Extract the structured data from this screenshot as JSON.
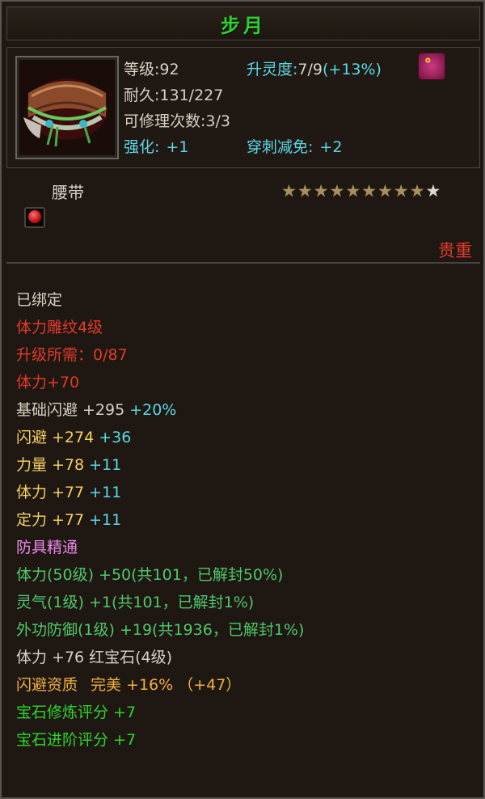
{
  "title": "步月",
  "header": {
    "level": "等级:92",
    "soul_label": "升灵度:",
    "soul_value": "7/9",
    "soul_bonus": "(+13%)",
    "durability": "耐久:131/227",
    "repair": "可修理次数:3/3",
    "enhance_label": "强化:",
    "enhance_value": "+1",
    "pierce_label": "穿刺减免:",
    "pierce_value": "+2",
    "soul_icon": "soul-glyph-icon"
  },
  "item": {
    "type": "腰带",
    "stars_total": 10,
    "stars_filled": 9,
    "rarity": "贵重"
  },
  "attributes": {
    "bound": "已绑定",
    "engrave": "体力雕纹4级",
    "upgrade": "升级所需：0/87",
    "stamina_engrave": "体力+70",
    "base_dodge_label": "基础闪避",
    "base_dodge_value": "+295",
    "base_dodge_bonus": "+20%",
    "dodge_label": "闪避",
    "dodge_value": "+274",
    "dodge_bonus": "+36",
    "power_label": "力量",
    "power_value": "+78",
    "power_bonus": "+11",
    "stamina_label": "体力",
    "stamina_value": "+77",
    "stamina_bonus": "+11",
    "focus_label": "定力",
    "focus_value": "+77",
    "focus_bonus": "+11",
    "mastery": "防具精通",
    "mastery_1": "体力(50级) +50(共101，已解封50%)",
    "mastery_2": "灵气(1级) +1(共101，已解封1%)",
    "mastery_3": "外功防御(1级) +19(共1936，已解封1%)",
    "gem_stat": "体力 +76",
    "gem_name": "红宝石(4级)",
    "quality_label": "闪避资质",
    "quality_grade": "完美",
    "quality_value": "+16%",
    "quality_bonus": "（+47）",
    "gem_refine": "宝石修炼评分 +7",
    "gem_advance": "宝石进阶评分 +7"
  }
}
